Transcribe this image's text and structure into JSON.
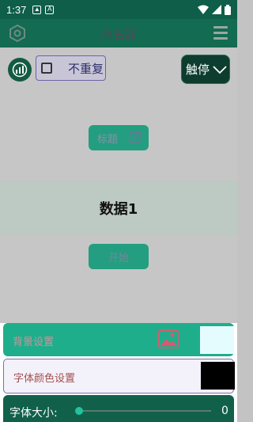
{
  "status_bar": {
    "time": "1:37",
    "notif_icons": [
      "gallery-icon",
      "a-icon"
    ],
    "right_icons": [
      "wifi-icon",
      "signal-icon",
      "battery-icon"
    ]
  },
  "app_bar": {
    "title": "点名器",
    "left_icon": "hexagon-settings-icon",
    "right_icon": "hamburger-menu-icon"
  },
  "toolbar": {
    "no_repeat_label": "不重复",
    "no_repeat_checked": false,
    "mode_label": "触停"
  },
  "main": {
    "title_button_label": "标题",
    "display_text": "数据1",
    "start_button_label": "开始"
  },
  "settings": {
    "background_label": "背景设置",
    "background_color": "#e5fcff",
    "font_color_label": "字体颜色设置",
    "font_color": "#000000",
    "font_size_label": "字体大小:",
    "font_size_value": "0"
  },
  "colors": {
    "primary": "#136b52",
    "accent": "#239e80",
    "status_bar": "#0e5e49"
  }
}
